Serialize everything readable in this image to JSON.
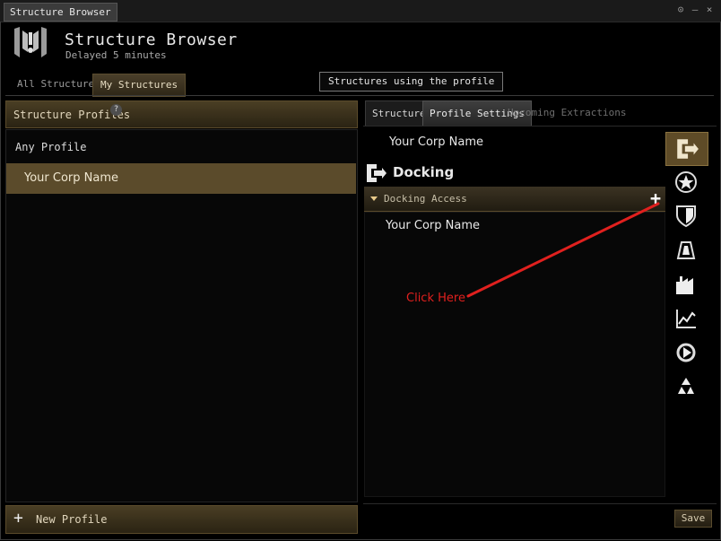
{
  "window": {
    "title": "Structure Browser",
    "controls": {
      "minimize": "⊙",
      "restore": "–",
      "close": "×"
    }
  },
  "header": {
    "title": "Structure Browser",
    "subtitle": "Delayed 5 minutes"
  },
  "top_tabs": [
    {
      "label": "All Structures",
      "active": false
    },
    {
      "label": "My Structures",
      "active": true
    }
  ],
  "tooltip": {
    "text": "Structures using the profile"
  },
  "left_panel": {
    "header": "Structure Profiles",
    "help": "?",
    "any_profile": "Any Profile",
    "profiles": [
      {
        "label": "Your Corp Name",
        "selected": true
      }
    ],
    "new_profile": "New Profile"
  },
  "right_panel": {
    "tabs": [
      {
        "label": "Structures",
        "state": "normal"
      },
      {
        "label": "Profile Settings",
        "state": "active"
      },
      {
        "label": "Upcoming Extractions",
        "state": "dim"
      }
    ],
    "corp_header": "Your Corp Name",
    "section": "Docking",
    "group": {
      "label": "Docking Access",
      "add": "+"
    },
    "entries": [
      "Your Corp Name"
    ],
    "save": "Save"
  },
  "annotation": {
    "text": "Click Here",
    "color": "#e0201e"
  },
  "side_icons": [
    {
      "name": "docking-icon",
      "active": true
    },
    {
      "name": "star-emblem-icon",
      "active": false
    },
    {
      "name": "shield-icon",
      "active": false
    },
    {
      "name": "reprocessing-cube-icon",
      "active": false
    },
    {
      "name": "factory-icon",
      "active": false
    },
    {
      "name": "market-chart-icon",
      "active": false
    },
    {
      "name": "jump-gate-icon",
      "active": false
    },
    {
      "name": "recycle-icon",
      "active": false
    }
  ],
  "colors": {
    "accent": "#5b4b2b",
    "annotation": "#e0201e"
  }
}
